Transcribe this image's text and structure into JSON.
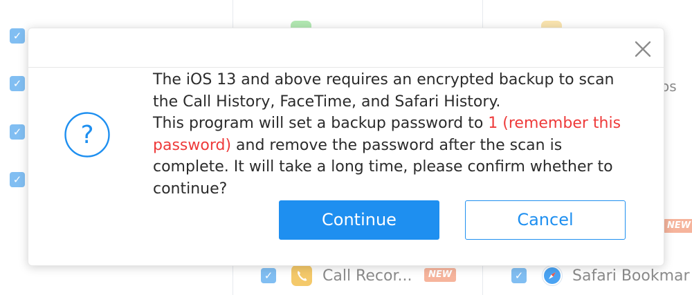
{
  "background": {
    "items": [
      {
        "label": "Call Recor...",
        "badge": "NEW"
      },
      {
        "label": "Safari Bookmar"
      }
    ],
    "partial_label": "os",
    "partial_badge": "NEW"
  },
  "dialog": {
    "close_icon": "close-icon",
    "question_icon": "question-circle-icon",
    "message": {
      "part1": "The iOS 13 and above requires an encrypted backup to scan the Call History, FaceTime, and Safari History.",
      "part2": "This program will set a backup password to ",
      "highlight": "1 (remember this password)",
      "part3": " and remove the password after the scan is complete. It will take a long time, please confirm whether to continue?"
    },
    "continue_label": "Continue",
    "cancel_label": "Cancel"
  },
  "colors": {
    "accent": "#1e8ff0",
    "warning_text": "#ee3a3a",
    "checkbox": "#57a9ee",
    "new_badge": "#f6b49c"
  }
}
